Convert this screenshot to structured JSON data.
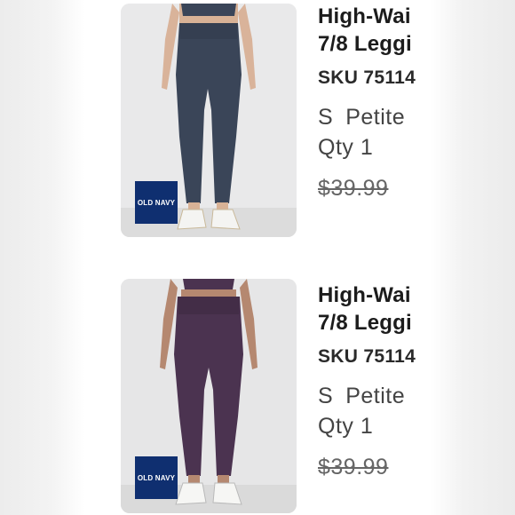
{
  "cart": {
    "items": [
      {
        "brand_logo": "OLD NAVY",
        "title_line1": "High-Wai",
        "title_line2": "7/8 Leggi",
        "sku": "SKU 75114",
        "size": "S",
        "fit": "Petite",
        "qty": "Qty 1",
        "price": "$39.99",
        "pants_color": "#3a4558",
        "top_color": "#3a4558"
      },
      {
        "brand_logo": "OLD NAVY",
        "title_line1": "High-Wai",
        "title_line2": "7/8 Leggi",
        "sku": "SKU 75114",
        "size": "S",
        "fit": "Petite",
        "qty": "Qty 1",
        "price": "$39.99",
        "pants_color": "#4b3350",
        "top_color": "#4b3350"
      }
    ]
  }
}
